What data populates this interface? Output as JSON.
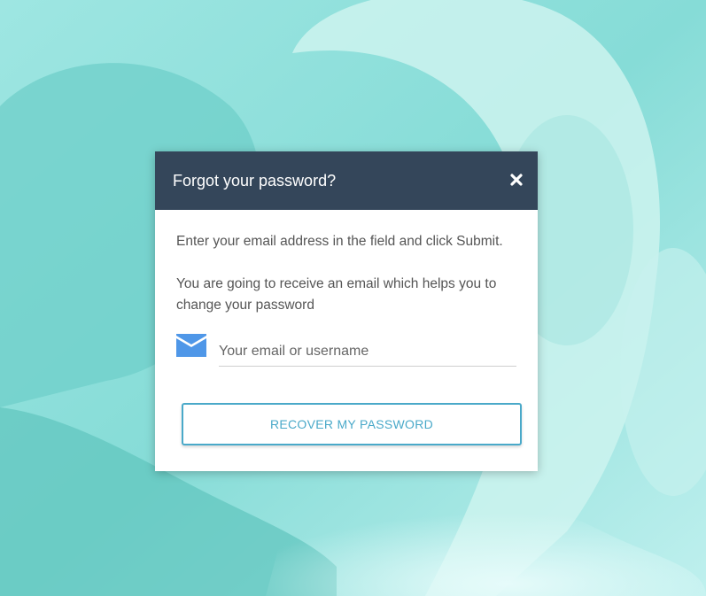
{
  "dialog": {
    "title": "Forgot your password?",
    "close_icon": "close-icon",
    "instruction_line1": "Enter your email address in the field and click Submit.",
    "instruction_line2": "You are going to receive an email which helps you to change your password",
    "email_icon": "envelope-icon",
    "email_placeholder": "Your email or username",
    "email_value": "",
    "submit_label": "RECOVER MY PASSWORD"
  },
  "colors": {
    "header_bg": "#34465a",
    "accent": "#4aa9c9",
    "envelope": "#4f97e8",
    "background_tint": "#8fe0dc"
  }
}
